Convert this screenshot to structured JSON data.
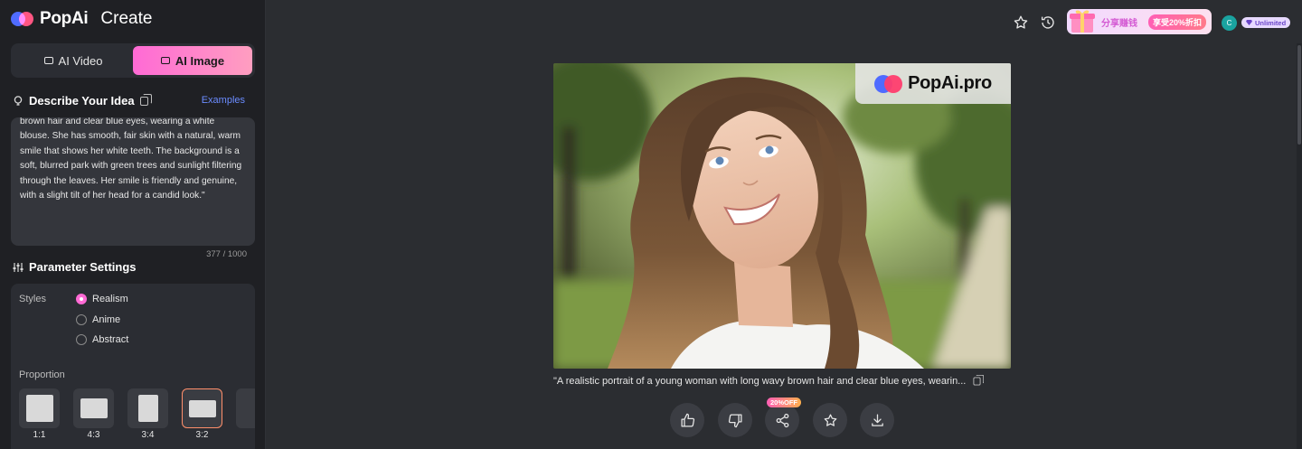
{
  "brand": {
    "name": "PopAi",
    "section": "Create"
  },
  "mode_switch": {
    "video_label": "AI Video",
    "image_label": "AI Image",
    "active": "image"
  },
  "idea": {
    "title": "Describe Your Idea",
    "examples_label": "Examples",
    "text": "brown hair and clear blue eyes, wearing a white blouse. She has smooth, fair skin with a natural, warm smile that shows her white teeth. The background is a soft, blurred park with green trees and sunlight filtering through the leaves. Her smile is friendly and genuine, with a slight tilt of her head for a candid look.\"",
    "char_count": "377 / 1000"
  },
  "parameters": {
    "title": "Parameter Settings",
    "styles_label": "Styles",
    "styles": [
      {
        "label": "Realism",
        "checked": true
      },
      {
        "label": "Anime",
        "checked": false
      },
      {
        "label": "Abstract",
        "checked": false
      }
    ],
    "proportion_label": "Proportion",
    "ratios": [
      {
        "label": "1:1",
        "selected": false
      },
      {
        "label": "4:3",
        "selected": false
      },
      {
        "label": "3:4",
        "selected": false
      },
      {
        "label": "3:2",
        "selected": true
      }
    ]
  },
  "topbar": {
    "promo_text": "分享赚钱",
    "promo_badge": "享受20%折扣",
    "avatar_initial": "C",
    "plan_label": "Unlimited"
  },
  "result": {
    "watermark": "PopAi.pro",
    "caption": "\"A realistic portrait of a young woman with long wavy brown hair and clear blue eyes, wearin...",
    "share_badge": "20%OFF"
  },
  "icons": {
    "idea": "lightbulb-icon",
    "params": "sliders-icon",
    "favorite": "star-icon",
    "history": "history-icon",
    "like": "thumbs-up-icon",
    "dislike": "thumbs-down-icon",
    "share": "share-icon",
    "download": "download-icon"
  },
  "colors": {
    "accent_pink": "#ff6ad5",
    "link_blue": "#6b8cff",
    "sidebar_bg": "#1f2024",
    "main_bg": "#2b2d31"
  }
}
